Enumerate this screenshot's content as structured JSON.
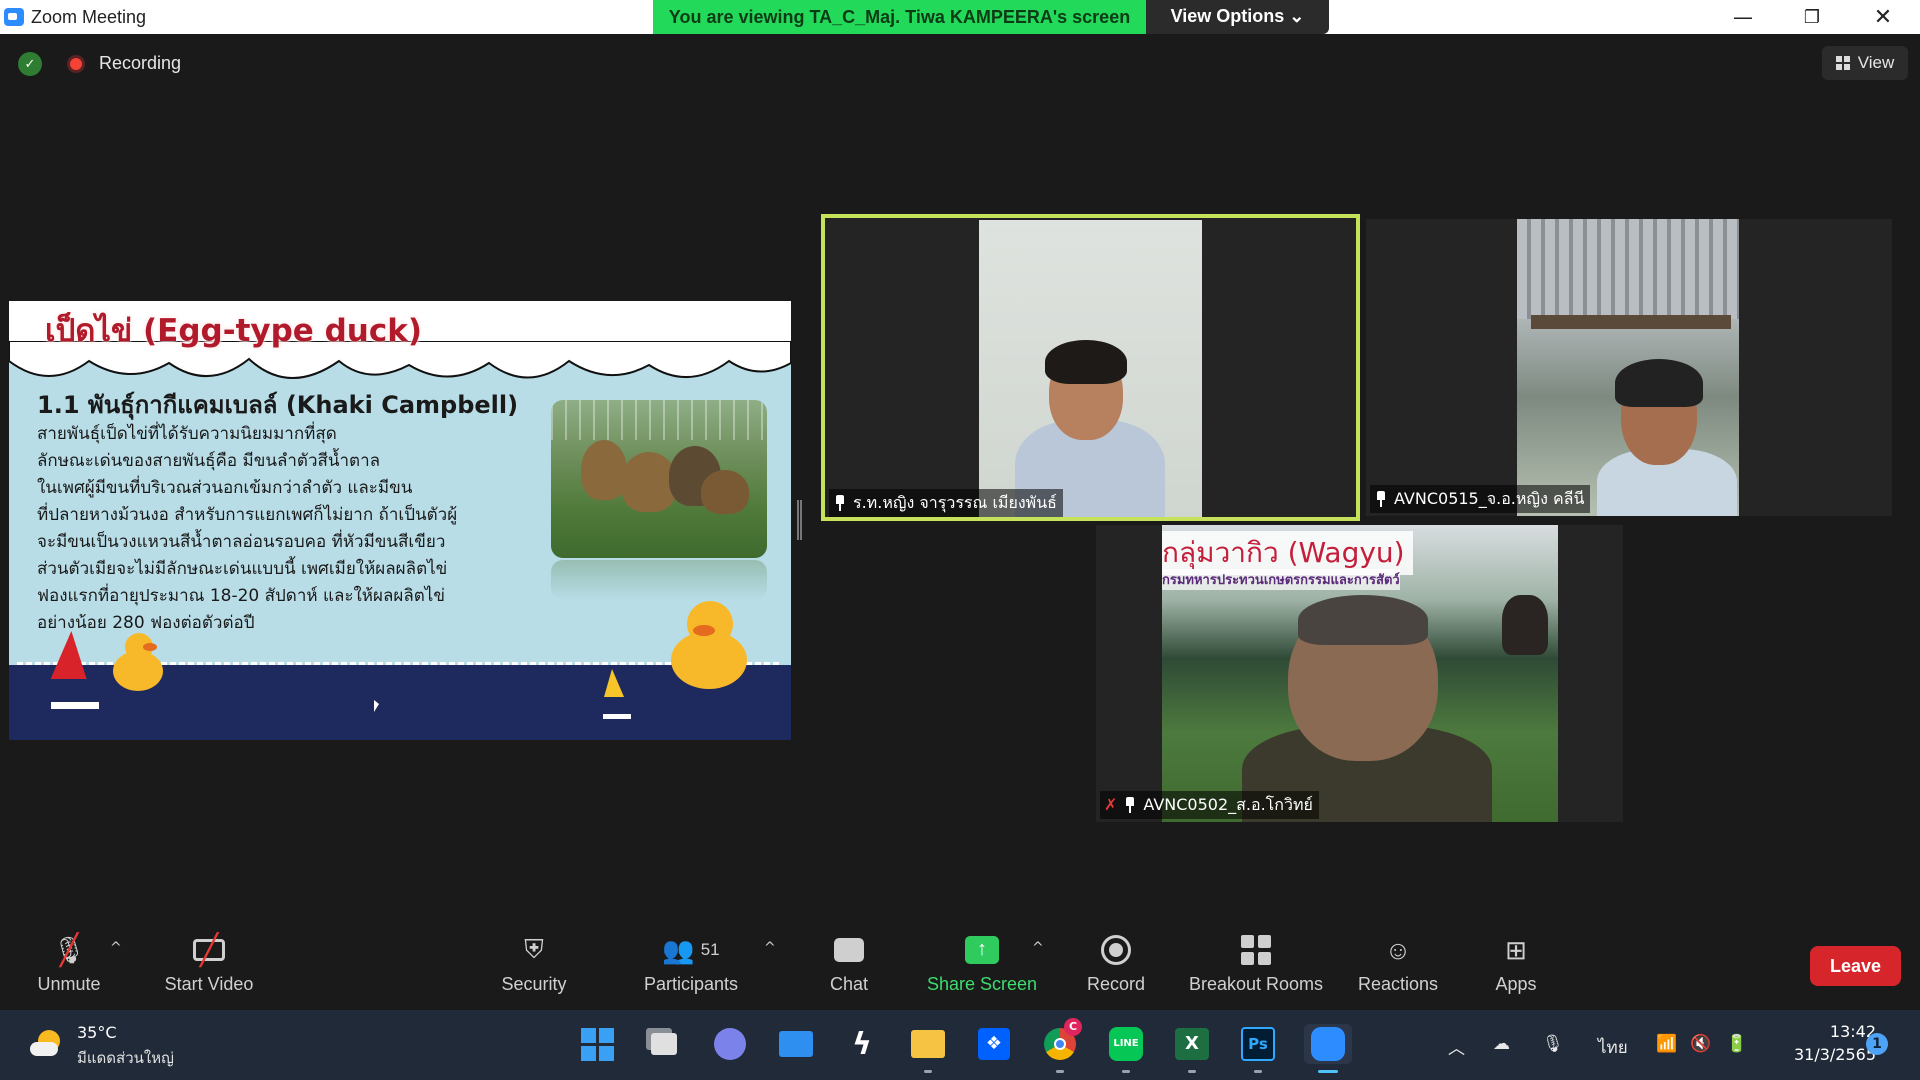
{
  "window": {
    "title": "Zoom Meeting",
    "viewing_banner": "You are viewing TA_C_Maj. Tiwa KAMPEERA's screen",
    "view_options": "View Options ⌄"
  },
  "meeting_bar": {
    "recording_label": "Recording",
    "view_label": "View"
  },
  "slide": {
    "title": "เป็ดไข่ (Egg-type duck)",
    "heading": "1.1 พันธุ์กากีแคมเบลล์ (Khaki Campbell)",
    "body_lines": [
      "        สายพันธุ์เป็ดไข่ที่ได้รับความนิยมมากที่สุด",
      "ลักษณะเด่นของสายพันธุ์คือ มีขนลำตัวสีน้ำตาล",
      "ในเพศผู้มีขนที่บริเวณส่วนอกเข้มกว่าลำตัว และมีขน",
      "ที่ปลายหางม้วนงอ สำหรับการแยกเพศก็ไม่ยาก ถ้าเป็นตัวผู้",
      "จะมีขนเป็นวงแหวนสีน้ำตาลอ่อนรอบคอ ที่หัวมีขนสีเขียว",
      "ส่วนตัวเมียจะไม่มีลักษณะเด่นแบบนี้ เพศเมียให้ผลผลิตไข่",
      "ฟองแรกที่อายุประมาณ 18-20 สัปดาห์ และให้ผลผลิตไข่",
      "อย่างน้อย 280 ฟองต่อตัวต่อปี"
    ]
  },
  "participants_tiles": [
    {
      "name": "ร.ท.หญิง จารุวรรณ เมียงพันธ์",
      "active_speaker": true,
      "muted": false
    },
    {
      "name": "AVNC0515_จ.อ.หญิง คลีนี",
      "active_speaker": false,
      "muted": false
    },
    {
      "name": "AVNC0502_ส.อ.โกวิทย์",
      "active_speaker": false,
      "muted": true,
      "background_title": "กลุ่มวากิว (Wagyu)",
      "background_subtitle": "กรมทหารประทวนเกษตรกรรมและการสัตว์"
    }
  ],
  "toolbar": {
    "unmute": "Unmute",
    "start_video": "Start Video",
    "security": "Security",
    "participants": "Participants",
    "participants_count": "51",
    "chat": "Chat",
    "share_screen": "Share Screen",
    "record": "Record",
    "breakout_rooms": "Breakout Rooms",
    "reactions": "Reactions",
    "apps": "Apps",
    "leave": "Leave"
  },
  "taskbar": {
    "weather_temp": "35°C",
    "weather_desc": "มีแดดส่วนใหญ่",
    "chrome_badge": "C",
    "language": "ไทย",
    "time": "13:42",
    "date": "31/3/2565",
    "notifications": "1",
    "apps": [
      "start",
      "task-view",
      "teams-chat",
      "mail",
      "app-bolt",
      "file-explorer",
      "dropbox",
      "chrome",
      "line",
      "excel",
      "photoshop",
      "zoom"
    ]
  },
  "colors": {
    "banner_green": "#23d959",
    "active_speaker_border": "#c6e15a",
    "share_green": "#2fcb5e",
    "leave_red": "#d6262b",
    "slide_bg": "#b8dde7",
    "slide_title_red": "#b11a2a"
  }
}
